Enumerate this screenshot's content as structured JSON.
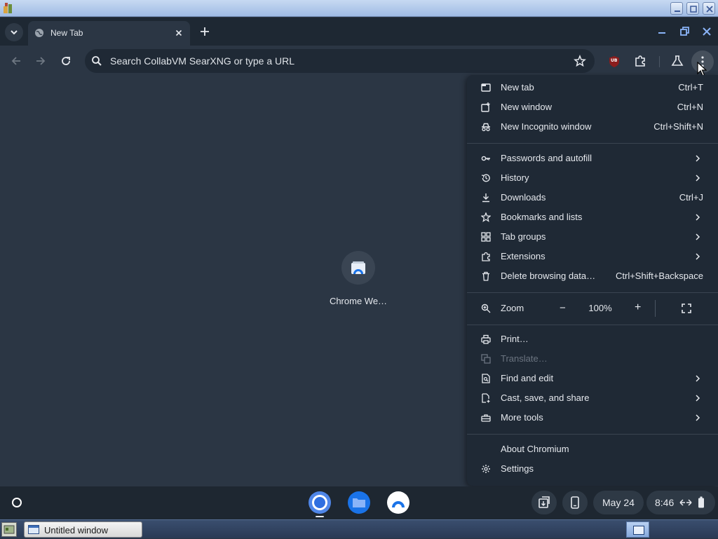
{
  "browser": {
    "tab": {
      "title": "New Tab"
    },
    "omnibox": {
      "placeholder": "Search CollabVM SearXNG or type a URL"
    },
    "extension_badge": "UB"
  },
  "new_tab_page": {
    "shortcut": {
      "label": "Chrome We…"
    }
  },
  "menu": {
    "group1": [
      {
        "label": "New tab",
        "shortcut": "Ctrl+T",
        "icon": "new-tab-icon"
      },
      {
        "label": "New window",
        "shortcut": "Ctrl+N",
        "icon": "new-window-icon"
      },
      {
        "label": "New Incognito window",
        "shortcut": "Ctrl+Shift+N",
        "icon": "incognito-icon"
      }
    ],
    "group2": [
      {
        "label": "Passwords and autofill",
        "icon": "key-icon",
        "submenu": true
      },
      {
        "label": "History",
        "icon": "history-icon",
        "submenu": true
      },
      {
        "label": "Downloads",
        "shortcut": "Ctrl+J",
        "icon": "download-icon"
      },
      {
        "label": "Bookmarks and lists",
        "icon": "star-icon",
        "submenu": true
      },
      {
        "label": "Tab groups",
        "icon": "tab-groups-icon",
        "submenu": true
      },
      {
        "label": "Extensions",
        "icon": "extensions-icon",
        "submenu": true
      },
      {
        "label": "Delete browsing data…",
        "shortcut": "Ctrl+Shift+Backspace",
        "icon": "trash-icon"
      }
    ],
    "zoom": {
      "label": "Zoom",
      "value": "100%",
      "minus": "−",
      "plus": "+"
    },
    "group3": [
      {
        "label": "Print…",
        "icon": "print-icon"
      },
      {
        "label": "Translate…",
        "icon": "translate-icon",
        "disabled": true
      },
      {
        "label": "Find and edit",
        "icon": "find-icon",
        "submenu": true
      },
      {
        "label": "Cast, save, and share",
        "icon": "cast-icon",
        "submenu": true
      },
      {
        "label": "More tools",
        "icon": "toolbox-icon",
        "submenu": true
      }
    ],
    "group4": [
      {
        "label": "About Chromium"
      },
      {
        "label": "Settings",
        "icon": "gear-icon"
      }
    ]
  },
  "shelf": {
    "date": "May 24",
    "time": "8:46"
  },
  "taskbar": {
    "window_button": "Untitled window"
  },
  "colors": {
    "accent": "#8ab4f8",
    "menu_bg": "#1f2935",
    "page_bg": "#2b3644"
  }
}
